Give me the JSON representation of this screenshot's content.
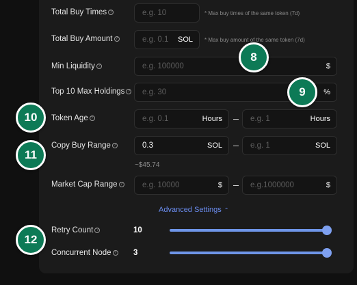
{
  "form": {
    "total_buy_times": {
      "label": "Total Buy Times",
      "placeholder": "e.g. 10",
      "note": "* Max buy times of the same token (7d)"
    },
    "total_buy_amount": {
      "label": "Total Buy Amount",
      "placeholder": "e.g. 0.1",
      "unit": "SOL",
      "note": "* Max buy amount of the same token (7d)"
    },
    "min_liquidity": {
      "label": "Min Liquidity",
      "placeholder": "e.g. 100000",
      "unit": "$"
    },
    "top10_max_holdings": {
      "label": "Top 10 Max Holdings",
      "placeholder": "e.g. 30",
      "unit": "%"
    },
    "token_age": {
      "label": "Token Age",
      "min_placeholder": "e.g. 0.1",
      "max_placeholder": "e.g. 1",
      "unit": "Hours"
    },
    "copy_buy_range": {
      "label": "Copy Buy Range",
      "min_value": "0.3",
      "max_placeholder": "e.g. 1",
      "unit": "SOL",
      "approx": "~$45.74"
    },
    "market_cap_range": {
      "label": "Market Cap Range",
      "min_placeholder": "e.g. 10000",
      "max_placeholder": "e.g.1000000",
      "unit": "$"
    },
    "advanced_settings": {
      "label": "Advanced Settings",
      "chevron": "chevron-up-icon"
    },
    "retry_count": {
      "label": "Retry Count",
      "value": "10",
      "fraction": 1.0
    },
    "concurrent_node": {
      "label": "Concurrent Node",
      "value": "3",
      "fraction": 1.0
    }
  },
  "badges": [
    "8",
    "9",
    "10",
    "11",
    "12"
  ],
  "colors": {
    "badge_green": "#0d7a56",
    "accent_blue": "#6b8df0",
    "slider": "#6e95e8",
    "panel": "#1b1b1b"
  }
}
